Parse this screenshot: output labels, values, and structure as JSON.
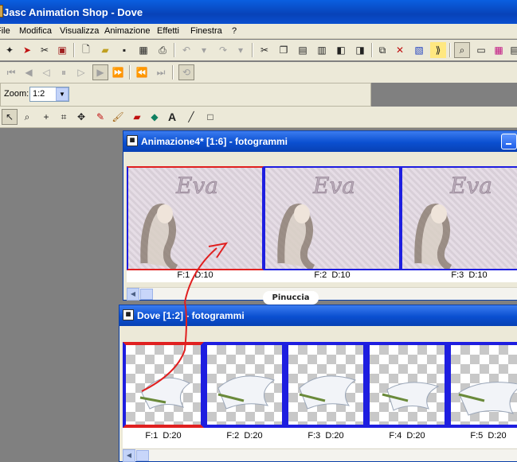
{
  "app": {
    "title": "Jasc Animation Shop - Dove"
  },
  "menu": [
    "File",
    "Modifica",
    "Visualizza",
    "Animazione",
    "Effetti",
    "Finestra",
    "?"
  ],
  "zoom": {
    "label": "Zoom:",
    "value": "1:2"
  },
  "windows": [
    {
      "title": "Animazione4* [1:6] - fotogrammi",
      "frames": [
        {
          "frame": "F:1",
          "delay": "D:10"
        },
        {
          "frame": "F:2",
          "delay": "D:10"
        },
        {
          "frame": "F:3",
          "delay": "D:10"
        }
      ]
    },
    {
      "title": "Dove [1:2] - fotogrammi",
      "frames": [
        {
          "frame": "F:1",
          "delay": "D:20"
        },
        {
          "frame": "F:2",
          "delay": "D:20"
        },
        {
          "frame": "F:3",
          "delay": "D:20"
        },
        {
          "frame": "F:4",
          "delay": "D:20"
        },
        {
          "frame": "F:5",
          "delay": "D:20"
        }
      ]
    }
  ],
  "watermark": "Pinuccia",
  "frame_image_text": "Eva",
  "colors": {
    "title_blue": "#0a4fd0",
    "selection_red": "#e02020",
    "frame_border": "#1e1ee0",
    "annotation_arrow": "#e02020"
  }
}
